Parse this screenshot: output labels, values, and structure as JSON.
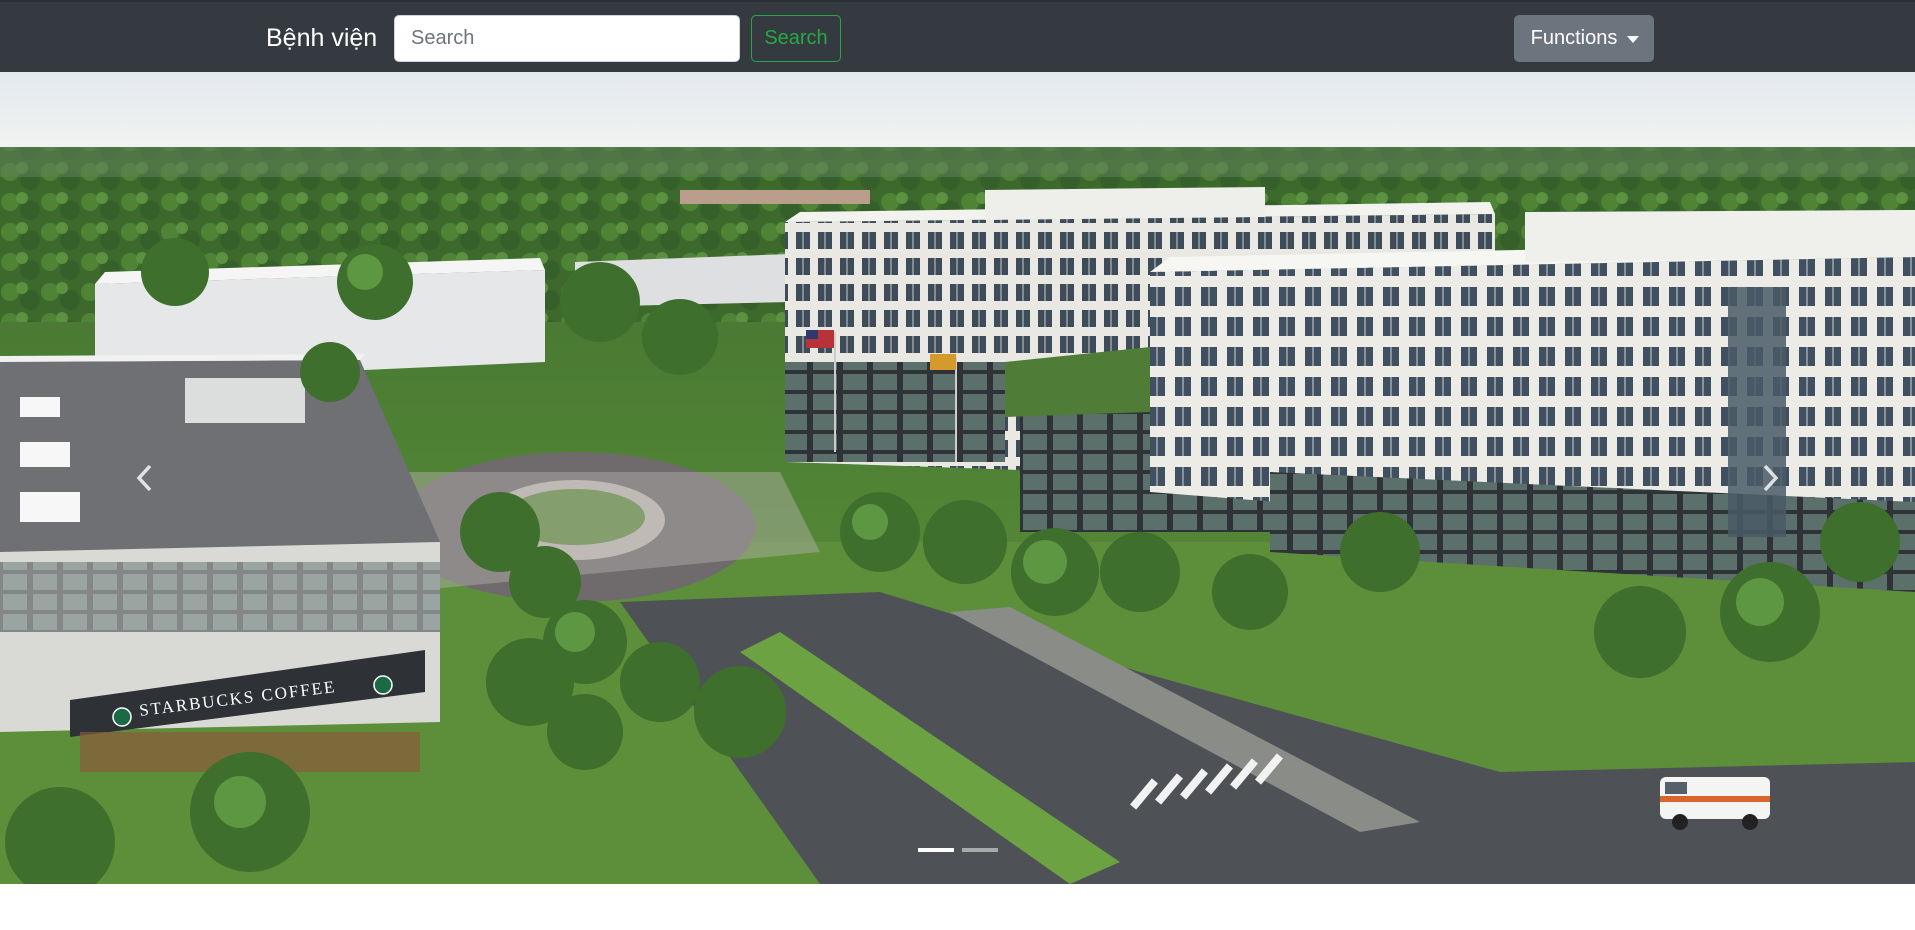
{
  "navbar": {
    "brand": "Bệnh viện",
    "search_placeholder": "Search",
    "search_button": "Search",
    "functions_button": "Functions"
  },
  "carousel": {
    "slides": [
      {
        "image": "hospital-campus-aerial-rendering",
        "sign_text": "STARBUCKS COFFEE"
      },
      {
        "image": "slide-2"
      }
    ],
    "active_index": 0,
    "prev_icon": "chevron-left-icon",
    "next_icon": "chevron-right-icon"
  },
  "colors": {
    "navbar_bg": "#343a40",
    "search_button": "#28a745",
    "functions_button": "#6c757d"
  }
}
